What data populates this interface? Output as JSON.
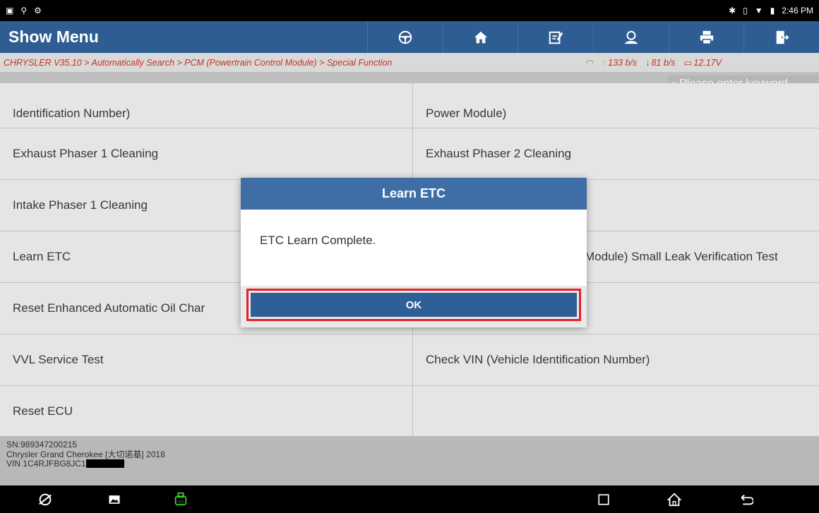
{
  "status_bar": {
    "time": "2:46 PM"
  },
  "header": {
    "title": "Show Menu",
    "toolbar": [
      "steering-wheel-icon",
      "home-icon",
      "report-icon",
      "user-icon",
      "print-icon",
      "exit-icon"
    ]
  },
  "breadcrumb": {
    "path": "CHRYSLER V35.10 > Automatically Search > PCM (Powertrain Control Module) > Special Function",
    "upload": "133 b/s",
    "download": "81 b/s",
    "voltage": "12.17V"
  },
  "search": {
    "placeholder": "Please enter keyword"
  },
  "functions": [
    {
      "left": "Identification Number)",
      "right": "Power Module)"
    },
    {
      "left": "Exhaust Phaser 1 Cleaning",
      "right": "Exhaust Phaser 2 Cleaning"
    },
    {
      "left": "Intake Phaser 1 Cleaning",
      "right": ""
    },
    {
      "left": "Learn ETC",
      "right": "Module) Small Leak Verification Test"
    },
    {
      "left": "Reset Enhanced Automatic Oil Char",
      "right": ""
    },
    {
      "left": "VVL Service Test",
      "right": "Check VIN (Vehicle Identification Number)"
    },
    {
      "left": "Reset ECU",
      "right": ""
    }
  ],
  "vehicle_info": {
    "sn": "SN:989347200215",
    "model": "Chrysler Grand Cherokee [大切诺基] 2018",
    "vin": "VIN 1C4RJFBG8JC1"
  },
  "dialog": {
    "title": "Learn ETC",
    "message": "ETC Learn Complete.",
    "ok_label": "OK"
  },
  "colors": {
    "header_bg": "#2d5d92",
    "accent_red": "#e8202a",
    "breadcrumb_text": "#c8321e"
  }
}
